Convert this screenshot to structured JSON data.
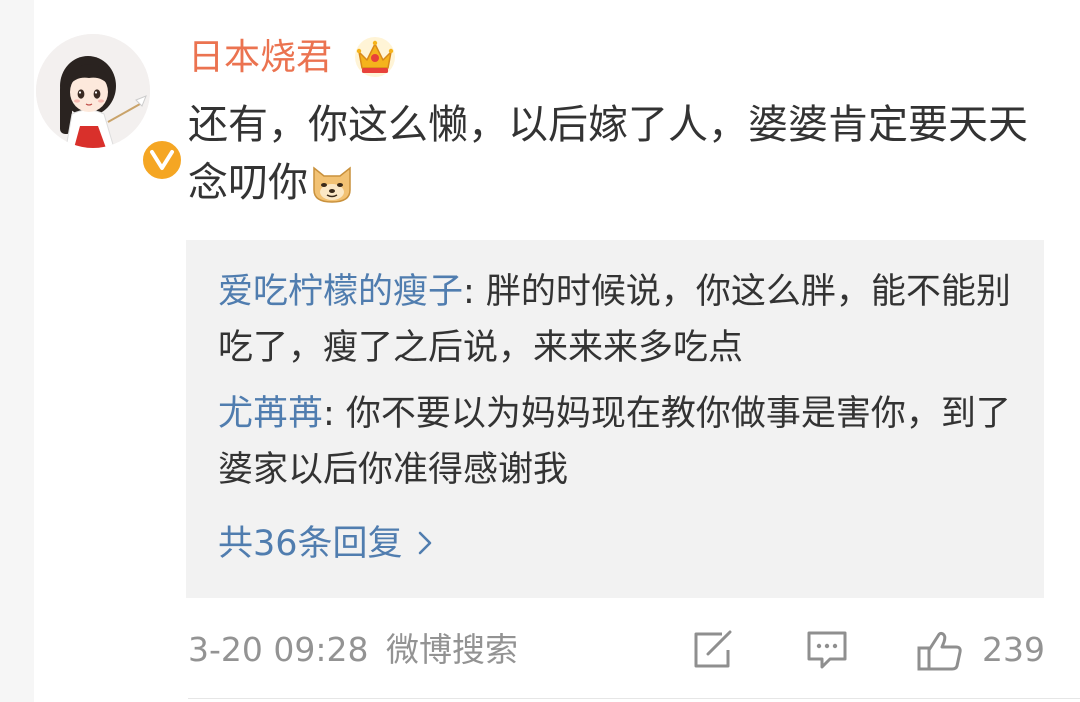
{
  "post": {
    "username": "日本烧君",
    "comment_text": "还有，你这么懒，以后嫁了人，婆婆肯定要天天念叨你",
    "emoji_icon": "doge-emoji-icon"
  },
  "replies": [
    {
      "author": "爱吃柠檬的瘦子",
      "text": ": 胖的时候说，你这么胖，能不能别吃了，瘦了之后说，来来来多吃点"
    },
    {
      "author": "尤苒苒",
      "text": ": 你不要以为妈妈现在教你做事是害你，到了婆家以后你准得感谢我"
    }
  ],
  "more_replies": "共36条回复",
  "footer": {
    "time": "3-20 09:28",
    "source": "微博搜索",
    "like_count": "239"
  },
  "colors": {
    "username": "#eb7350",
    "link": "#507daf",
    "text": "#333333",
    "meta": "#939393",
    "reply_bg": "#f2f2f2",
    "verified": "#f5a623"
  }
}
